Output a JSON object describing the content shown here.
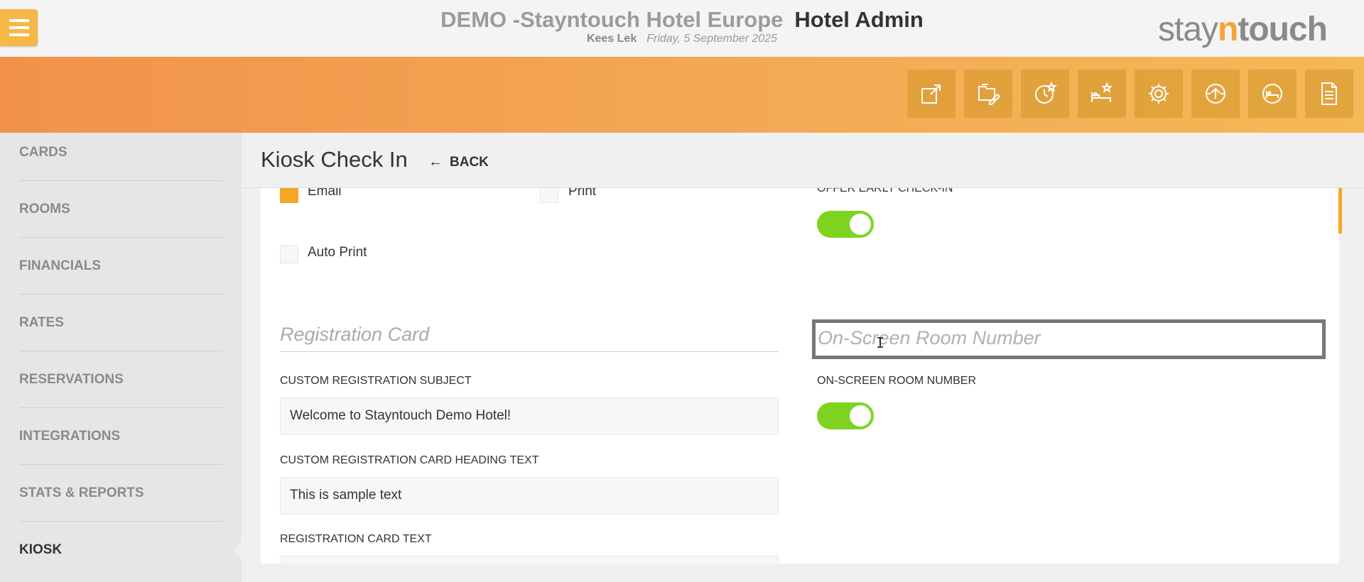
{
  "header": {
    "hotel_name": "DEMO -Stayntouch Hotel Europe",
    "section": "Hotel Admin",
    "user": "Kees Lek",
    "date": "Friday, 5 September 2025",
    "logo_part1": "stay",
    "logo_part2": "n",
    "logo_part3": "touch"
  },
  "toolbar": {
    "icons": [
      "external-link-icon",
      "folder-edit-icon",
      "clock-star-icon",
      "bed-star-icon",
      "gear-icon",
      "upload-icon",
      "bed-icon",
      "document-icon"
    ]
  },
  "sidebar": {
    "items": [
      {
        "label": "CARDS"
      },
      {
        "label": "ROOMS"
      },
      {
        "label": "FINANCIALS"
      },
      {
        "label": "RATES"
      },
      {
        "label": "RESERVATIONS"
      },
      {
        "label": "INTEGRATIONS"
      },
      {
        "label": "STATS & REPORTS"
      },
      {
        "label": "KIOSK",
        "active": true
      }
    ]
  },
  "page": {
    "title": "Kiosk Check In",
    "back_label": "BACK"
  },
  "form": {
    "email_label": "Email",
    "email_checked": true,
    "print_label": "Print",
    "print_checked": false,
    "auto_print_label": "Auto Print",
    "auto_print_checked": false,
    "early_checkin_label": "OFFER EARLY CHECK-IN",
    "early_checkin_on": true,
    "registration_section": "Registration Card",
    "subject_label": "CUSTOM REGISTRATION SUBJECT",
    "subject_value": "Welcome to Stayntouch Demo Hotel!",
    "heading_label": "CUSTOM REGISTRATION CARD HEADING TEXT",
    "heading_value": "This is sample text",
    "card_text_label": "REGISTRATION CARD TEXT",
    "room_section_placeholder": "On-Screen Room Number",
    "room_number_label": "ON-SCREEN ROOM NUMBER",
    "room_number_on": true
  },
  "colors": {
    "accent": "#f5a623",
    "toggle_on": "#7ed321"
  }
}
